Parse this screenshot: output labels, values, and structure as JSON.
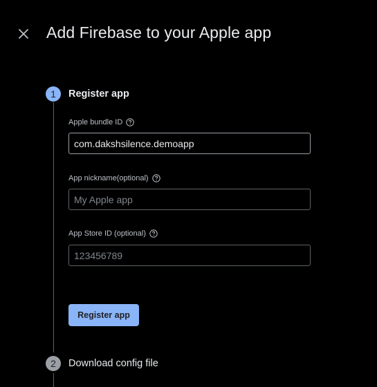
{
  "dialog": {
    "title": "Add Firebase to your Apple app",
    "close_icon": "close-icon"
  },
  "steps": [
    {
      "number": "1",
      "title": "Register app",
      "state": "active",
      "fields": [
        {
          "label": "Apple bundle ID",
          "value": "com.dakshsilence.demoapp",
          "placeholder": "",
          "icon": "help-icon"
        },
        {
          "label": "App nickname(optional)",
          "value": "",
          "placeholder": "My Apple app",
          "icon": "help-icon"
        },
        {
          "label": "App Store ID (optional)",
          "value": "",
          "placeholder": "123456789",
          "icon": "help-icon"
        }
      ],
      "button_label": "Register app"
    },
    {
      "number": "2",
      "title": "Download config file",
      "state": "inactive"
    }
  ],
  "colors": {
    "background": "#000000",
    "accent": "#8ab4f8",
    "text": "#e8eaed",
    "muted": "#bdc1c6",
    "border": "#5f6368"
  }
}
